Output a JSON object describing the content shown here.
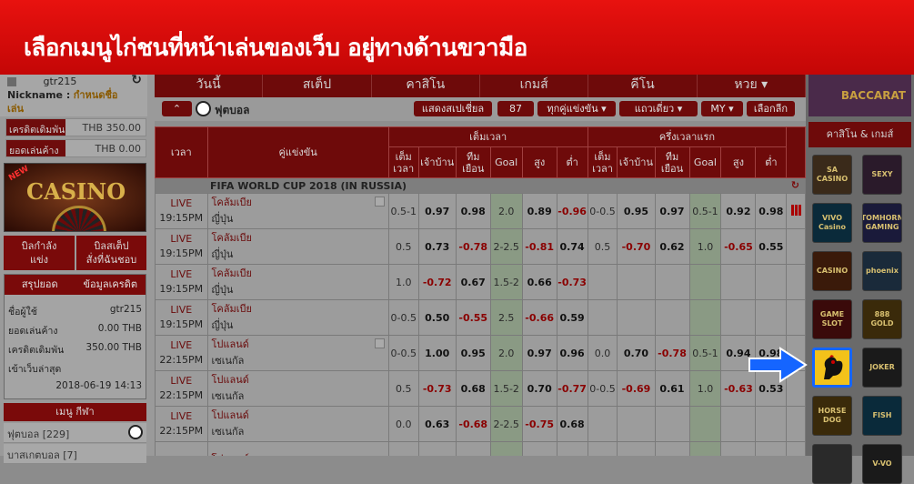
{
  "banner": {
    "text": "เลือกเมนูไก่ชนที่หน้าเล่นของเว็บ อยู่ทางด้านขวามือ"
  },
  "user": {
    "username": "gtr215",
    "nickname_label": "Nickname :",
    "nickname_value": "กำหนดชื่อ",
    "nickname_cont": "เล่น",
    "credit_label": "เครดิตเดิมพัน",
    "credit_value": "THB 350.00",
    "outstanding_label": "ยอดเล่นค้าง",
    "outstanding_value": "THB 0.00"
  },
  "promo": {
    "new": "NEW",
    "title": "CASINO"
  },
  "leftnav": {
    "bets_live": "บิลกำลัง\nแข่ง",
    "bets_step": "บิลสเต็ป\nสั่งที่ฉันชอบ"
  },
  "summary": {
    "tab1": "สรุปยอด",
    "tab2": "ข้อมูลเครดิต",
    "rows": [
      [
        "ชื่อผู้ใช้",
        "gtr215"
      ],
      [
        "ยอดเล่นค้าง",
        "0.00 THB"
      ],
      [
        "เครดิตเดิมพัน",
        "350.00 THB"
      ],
      [
        "เข้าเว็บล่าสุด",
        ""
      ],
      [
        "",
        "2018-06-19 14:13"
      ]
    ]
  },
  "sportsmenu": {
    "title": "เมนู กีฬา",
    "football": "ฟุตบอล [229]",
    "other": "บาสเกตบอล [7]"
  },
  "topnav": [
    "วันนี้",
    "สเต็ป",
    "คาสิโน",
    "เกมส์",
    "คีโน",
    "หวย ▾"
  ],
  "toolbar": {
    "sport": "ฟุตบอล",
    "btn1": "แสดงสเปเชี่ยล",
    "btn2": "87",
    "btn3": "ทุกคู่แข่งขัน ▾",
    "btn4": "แถวเดี่ยว ▾",
    "btn5": "MY ▾",
    "btn6": "เลือกลีก"
  },
  "table": {
    "h_time": "เวลา",
    "h_match": "คู่แข่งขัน",
    "h_full": "เต็มเวลา",
    "h_half": "ครึ่งเวลาแรก",
    "sub": [
      "เต็ม\nเวลา",
      "เจ้าบ้าน",
      "ทีม\nเยือน",
      "Goal",
      "สูง",
      "ต่ำ",
      "เต็ม\nเวลา",
      "เจ้าบ้าน",
      "ทีม\nเยือน",
      "Goal",
      "สูง",
      "ต่ำ"
    ],
    "league": "FIFA WORLD CUP 2018 (IN RUSSIA)",
    "rows": [
      {
        "live": "LIVE",
        "time": "19:15PM",
        "home": "โคลัมเบีย",
        "away": "ญี่ปุ่น",
        "v": [
          "0.5-1",
          "0.97",
          "0.98",
          "2.0",
          "0.89",
          "-0.96",
          "0-0.5",
          "0.95",
          "0.97",
          "0.5-1",
          "0.92",
          "0.98"
        ]
      },
      {
        "live": "LIVE",
        "time": "19:15PM",
        "home": "โคลัมเบีย",
        "away": "ญี่ปุ่น",
        "v": [
          "0.5",
          "0.73",
          "-0.78",
          "2-2.5",
          "-0.81",
          "0.74",
          "0.5",
          "-0.70",
          "0.62",
          "1.0",
          "-0.65",
          "0.55"
        ]
      },
      {
        "live": "LIVE",
        "time": "19:15PM",
        "home": "โคลัมเบีย",
        "away": "ญี่ปุ่น",
        "v": [
          "1.0",
          "-0.72",
          "0.67",
          "1.5-2",
          "0.66",
          "-0.73",
          "",
          "",
          "",
          "",
          "",
          ""
        ]
      },
      {
        "live": "LIVE",
        "time": "19:15PM",
        "home": "โคลัมเบีย",
        "away": "ญี่ปุ่น",
        "v": [
          "0-0.5",
          "0.50",
          "-0.55",
          "2.5",
          "-0.66",
          "0.59",
          "",
          "",
          "",
          "",
          "",
          ""
        ]
      },
      {
        "live": "LIVE",
        "time": "22:15PM",
        "home": "โปแลนด์",
        "away": "เซเนกัล",
        "v": [
          "0-0.5",
          "1.00",
          "0.95",
          "2.0",
          "0.97",
          "0.96",
          "0.0",
          "0.70",
          "-0.78",
          "0.5-1",
          "0.94",
          "0.98"
        ]
      },
      {
        "live": "LIVE",
        "time": "22:15PM",
        "home": "โปแลนด์",
        "away": "เซเนกัล",
        "v": [
          "0.5",
          "-0.73",
          "0.68",
          "1.5-2",
          "0.70",
          "-0.77",
          "0-0.5",
          "-0.69",
          "0.61",
          "1.0",
          "-0.63",
          "0.53"
        ]
      },
      {
        "live": "LIVE",
        "time": "22:15PM",
        "home": "โปแลนด์",
        "away": "เซเนกัล",
        "v": [
          "0.0",
          "0.63",
          "-0.68",
          "2-2.5",
          "-0.75",
          "0.68",
          "",
          "",
          "",
          "",
          "",
          ""
        ]
      },
      {
        "live": "",
        "time": "",
        "home": "โปแลนด์",
        "away": "",
        "v": [
          "",
          "",
          "",
          "",
          "",
          "",
          "",
          "",
          "",
          "",
          "",
          ""
        ]
      }
    ]
  },
  "right": {
    "promo": "BACCARAT",
    "header": "คาสิโน & เกมส์",
    "tiles": [
      "SA CASINO",
      "SEXY",
      "VIVO Casino",
      "TOMHORN GAMING",
      "CASINO",
      "phoenix",
      "GAME SLOT",
      "888 GOLD",
      "",
      "JOKER",
      "HORSE DOG",
      "FISH",
      "",
      "V-VO"
    ]
  }
}
